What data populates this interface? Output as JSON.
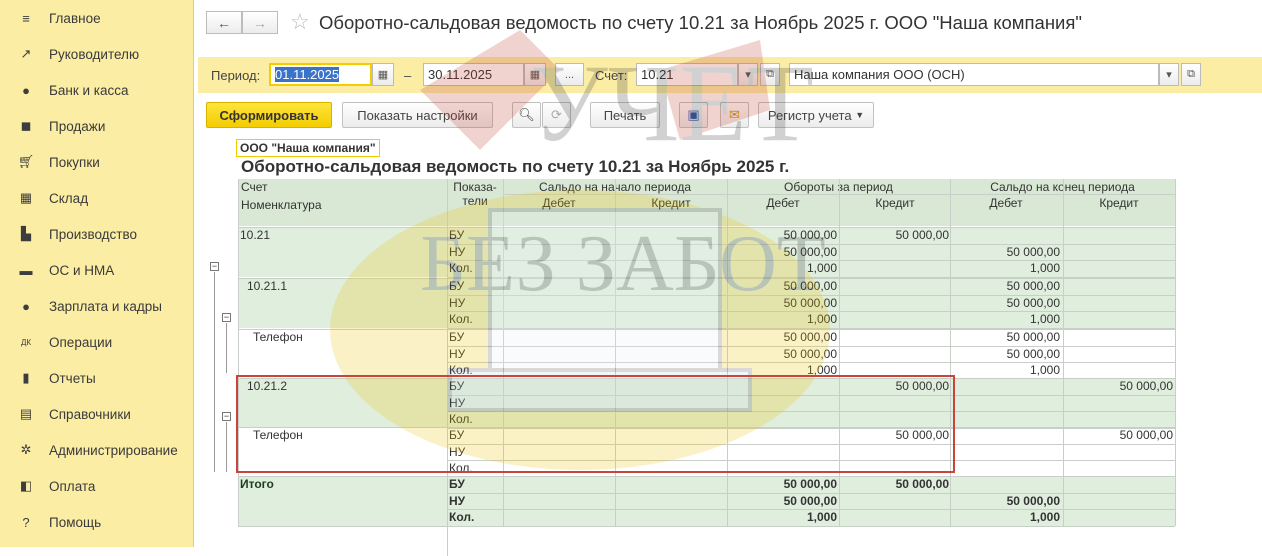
{
  "sidebar": {
    "items": [
      {
        "label": "Главное",
        "icon": "menu-icon"
      },
      {
        "label": "Руководителю",
        "icon": "trend-icon"
      },
      {
        "label": "Банк и касса",
        "icon": "coin-icon"
      },
      {
        "label": "Продажи",
        "icon": "bag-icon"
      },
      {
        "label": "Покупки",
        "icon": "cart-icon"
      },
      {
        "label": "Склад",
        "icon": "warehouse-icon"
      },
      {
        "label": "Производство",
        "icon": "factory-icon"
      },
      {
        "label": "ОС и НМА",
        "icon": "truck-icon"
      },
      {
        "label": "Зарплата и кадры",
        "icon": "person-icon"
      },
      {
        "label": "Операции",
        "icon": "dtkt-icon"
      },
      {
        "label": "Отчеты",
        "icon": "bar-chart-icon"
      },
      {
        "label": "Справочники",
        "icon": "book-icon"
      },
      {
        "label": "Администрирование",
        "icon": "gear-icon"
      },
      {
        "label": "Оплата",
        "icon": "wallet-icon"
      },
      {
        "label": "Помощь",
        "icon": "question-icon"
      }
    ]
  },
  "header": {
    "back": "←",
    "forward": "→",
    "star": "☆",
    "title": "Оборотно-сальдовая ведомость по счету 10.21 за Ноябрь 2025 г. ООО \"Наша компания\""
  },
  "period": {
    "label": "Период:",
    "from": "01.11.2025",
    "dash": "–",
    "to": "30.11.2025",
    "dots": "...",
    "account_label": "Счет:",
    "account": "10.21",
    "company": "Наша компания ООО (ОСН)"
  },
  "toolbar": {
    "generate": "Сформировать",
    "settings": "Показать настройки",
    "print": "Печать",
    "register": "Регистр учета"
  },
  "report": {
    "org": "ООО \"Наша компания\"",
    "title": "Оборотно-сальдовая ведомость по счету 10.21 за Ноябрь 2025 г.",
    "headers": {
      "account": "Счет",
      "nomenclature": "Номенклатура",
      "indicator": "Показа-\nтели",
      "opening": "Сальдо на начало периода",
      "turnover": "Обороты за период",
      "closing": "Сальдо на конец периода",
      "debit": "Дебет",
      "credit": "Кредит"
    },
    "rows": [
      {
        "name": "10.21",
        "ind": [
          "БУ",
          "НУ",
          "Кол."
        ],
        "tdeb": [
          "50 000,00",
          "50 000,00",
          "1,000"
        ],
        "tcred": [
          "50 000,00",
          "",
          ""
        ],
        "cdeb": [
          "",
          "50 000,00",
          "1,000"
        ],
        "ccred": [
          "",
          "",
          ""
        ]
      },
      {
        "name": "10.21.1",
        "ind": [
          "БУ",
          "НУ",
          "Кол."
        ],
        "tdeb": [
          "50 000,00",
          "50 000,00",
          "1,000"
        ],
        "tcred": [
          "",
          "",
          ""
        ],
        "cdeb": [
          "50 000,00",
          "50 000,00",
          "1,000"
        ],
        "ccred": [
          "",
          "",
          ""
        ]
      },
      {
        "name": "Телефон",
        "ind": [
          "БУ",
          "НУ",
          "Кол."
        ],
        "tdeb": [
          "50 000,00",
          "50 000,00",
          "1,000"
        ],
        "tcred": [
          "",
          "",
          ""
        ],
        "cdeb": [
          "50 000,00",
          "50 000,00",
          "1,000"
        ],
        "ccred": [
          "",
          "",
          ""
        ]
      },
      {
        "name": "10.21.2",
        "ind": [
          "БУ",
          "НУ",
          "Кол."
        ],
        "tdeb": [
          "",
          "",
          ""
        ],
        "tcred": [
          "50 000,00",
          "",
          ""
        ],
        "cdeb": [
          "",
          "",
          ""
        ],
        "ccred": [
          "50 000,00",
          "",
          ""
        ]
      },
      {
        "name": "Телефон",
        "ind": [
          "БУ",
          "НУ",
          "Кол."
        ],
        "tdeb": [
          "",
          "",
          ""
        ],
        "tcred": [
          "50 000,00",
          "",
          ""
        ],
        "cdeb": [
          "",
          "",
          ""
        ],
        "ccred": [
          "50 000,00",
          "",
          ""
        ]
      },
      {
        "name": "Итого",
        "ind": [
          "БУ",
          "НУ",
          "Кол."
        ],
        "tdeb": [
          "50 000,00",
          "50 000,00",
          "1,000"
        ],
        "tcred": [
          "50 000,00",
          "",
          ""
        ],
        "cdeb": [
          "",
          "50 000,00",
          "1,000"
        ],
        "ccred": [
          "",
          "",
          ""
        ]
      }
    ]
  },
  "watermark": {
    "line1": "УЧЕТ",
    "line2": "БЕЗ ЗАБОТ"
  },
  "colors": {
    "sidebar": "#fbeda4",
    "primary": "#f3cd00",
    "row_green": "#dfeedd",
    "highlight": "#c8453b"
  }
}
